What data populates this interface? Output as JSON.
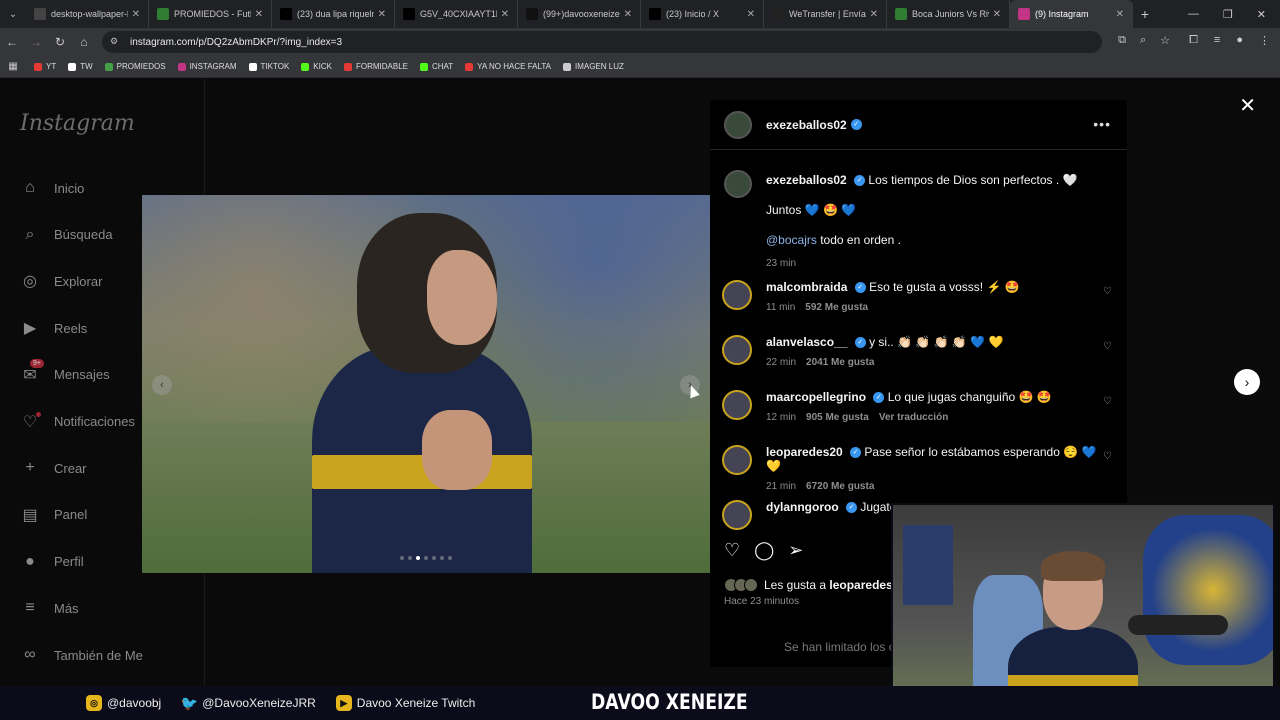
{
  "browser": {
    "tabs": [
      {
        "title": "desktop-wallpaper-lig",
        "fav_color": "#444"
      },
      {
        "title": "PROMIEDOS - Futbol",
        "fav_color": "#2e7d32"
      },
      {
        "title": "(23) dua lipa riquelme",
        "fav_color": "#000"
      },
      {
        "title": "G5V_40CXIAAYT1b (1",
        "fav_color": "#000"
      },
      {
        "title": "(99+)davooxeneize (",
        "fav_color": "#111"
      },
      {
        "title": "(23) Inicio / X",
        "fav_color": "#000"
      },
      {
        "title": "WeTransfer | Envía ar",
        "fav_color": "#222"
      },
      {
        "title": "Boca Juniors Vs River",
        "fav_color": "#2e7d32"
      },
      {
        "title": "(9) Instagram",
        "fav_color": "#c13584"
      }
    ],
    "url": "instagram.com/p/DQ2zAbmDKPr/?img_index=3",
    "bookmarks": [
      {
        "label": "YT",
        "color": "#e53935"
      },
      {
        "label": "TW",
        "color": "#fff"
      },
      {
        "label": "PROMIEDOS",
        "color": "#43a047"
      },
      {
        "label": "INSTAGRAM",
        "color": "#c13584"
      },
      {
        "label": "TIKTOK",
        "color": "#fff"
      },
      {
        "label": "KICK",
        "color": "#53fc18"
      },
      {
        "label": "FORMIDABLE",
        "color": "#e53935"
      },
      {
        "label": "CHAT",
        "color": "#53fc18"
      },
      {
        "label": "YA NO HACE FALTA",
        "color": "#e53935"
      },
      {
        "label": "IMAGEN LUZ",
        "color": "#ccc"
      }
    ]
  },
  "sidebar": {
    "logo": "Instagram",
    "items": [
      {
        "label": "Inicio",
        "icon": "home-icon"
      },
      {
        "label": "Búsqueda",
        "icon": "search-icon"
      },
      {
        "label": "Explorar",
        "icon": "compass-icon"
      },
      {
        "label": "Reels",
        "icon": "reels-icon"
      },
      {
        "label": "Mensajes",
        "icon": "messenger-icon",
        "badge": "9+"
      },
      {
        "label": "Notificaciones",
        "icon": "heart-icon"
      },
      {
        "label": "Crear",
        "icon": "plus-icon"
      },
      {
        "label": "Panel",
        "icon": "chart-icon"
      },
      {
        "label": "Perfil",
        "icon": "profile-icon"
      },
      {
        "label": "Más",
        "icon": "menu-icon"
      },
      {
        "label": "También de Me",
        "icon": "meta-icon"
      }
    ]
  },
  "post": {
    "author": "exezeballos02",
    "caption_line1": "Los tiempos de Dios son perfectos . 🤍",
    "caption_line2": "Juntos 💙 🤩 💙",
    "caption_mention": "@bocajrs",
    "caption_line3_rest": " todo en orden .",
    "caption_time": "23 min",
    "carousel_index": 3,
    "carousel_total": 7,
    "comments": [
      {
        "user": "malcombraida",
        "text": "Eso te gusta a vosss! ⚡ 🤩",
        "time": "11 min",
        "likes": "592 Me gusta",
        "extra": ""
      },
      {
        "user": "alanvelasco__",
        "text": "y si.. 👏🏻 👏🏻 👏🏻 👏🏻 💙 💛",
        "time": "22 min",
        "likes": "2041 Me gusta",
        "extra": ""
      },
      {
        "user": "maarcopellegrino",
        "text": "Lo que jugas changuiño 🤩 🤩",
        "time": "12 min",
        "likes": "905 Me gusta",
        "extra": "Ver traducción"
      },
      {
        "user": "leoparedes20",
        "text": "Pase señor lo estábamos esperando 😌 💙 💛",
        "time": "21 min",
        "likes": "6720 Me gusta",
        "extra": ""
      },
      {
        "user": "dylanngoroo",
        "text": "Jugatee",
        "time": "",
        "likes": "",
        "extra": ""
      }
    ],
    "liked_by": "Les gusta a ",
    "liked_by_user": "leoparedes2",
    "posted_ago": "Hace 23 minutos",
    "limited_notice": "Se han limitado los c"
  },
  "stream": {
    "instagram": "@davoobj",
    "twitter": "@DavooXeneizeJRR",
    "youtube": "Davoo Xeneize Twitch",
    "name": "DAVOO XENEIZE"
  }
}
